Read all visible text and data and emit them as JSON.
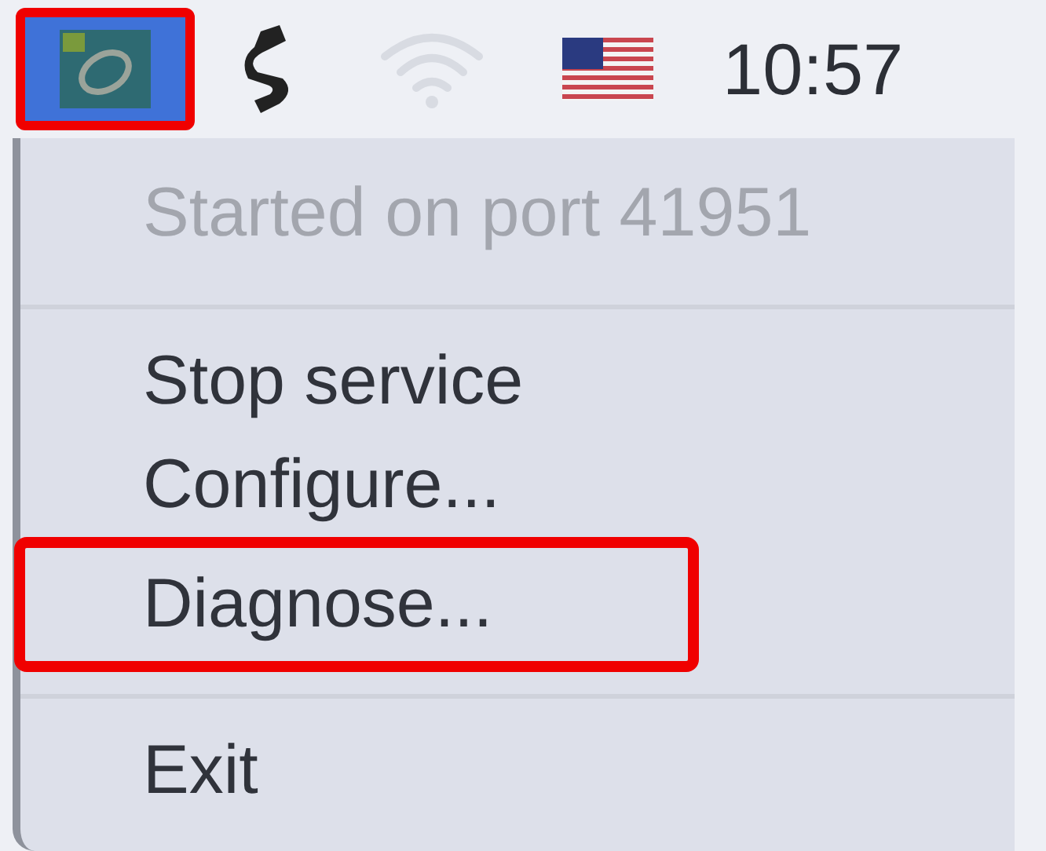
{
  "menu_bar": {
    "app_icon": {
      "selected": true,
      "highlighted": true
    },
    "clock": "10:57"
  },
  "menu": {
    "items": [
      {
        "kind": "item",
        "label": "Started on port 41951",
        "disabled": true,
        "highlighted": false
      },
      {
        "kind": "separator"
      },
      {
        "kind": "item",
        "label": "Stop service",
        "disabled": false,
        "highlighted": false
      },
      {
        "kind": "item",
        "label": "Configure...",
        "disabled": false,
        "highlighted": false
      },
      {
        "kind": "item",
        "label": "Diagnose...",
        "disabled": false,
        "highlighted": true
      },
      {
        "kind": "separator"
      },
      {
        "kind": "item",
        "label": "Exit",
        "disabled": false,
        "highlighted": false
      }
    ]
  }
}
